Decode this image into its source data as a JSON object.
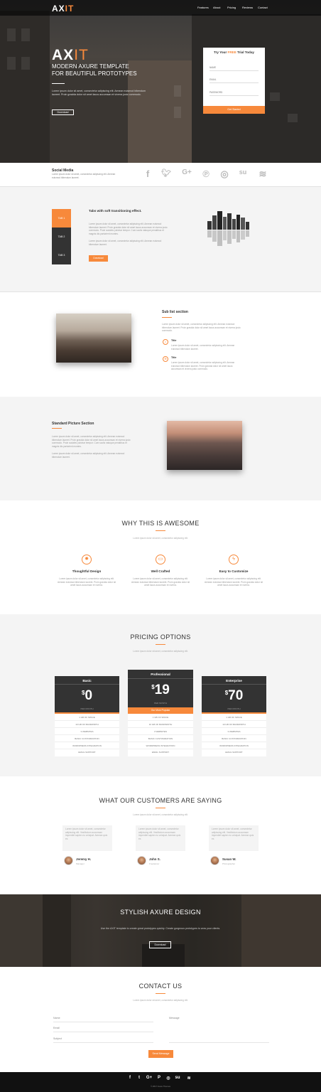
{
  "nav": {
    "logo_main": "AX",
    "logo_accent": "IT",
    "items": [
      "Features",
      "About",
      "Pricing",
      "Reviews",
      "Contact"
    ]
  },
  "hero": {
    "title_main": "AX",
    "title_accent": "IT",
    "subtitle_line1": "MODERN AXURE TEMPLATE",
    "subtitle_line2": "FOR BEAUTIFUL PROTOTYPES",
    "text": "Lorem ipsum dolor sit amet, consectetur adipiscing elit. Aenean euismod bibendum laoreet. Proin gravida dolor sit amet lacus accumsan et viverra justo commodo.",
    "button": "Download"
  },
  "trial": {
    "title_pre": "Try Your ",
    "title_accent": "FREE",
    "title_post": " Trial Today",
    "fields": [
      "NAME",
      "EMAIL",
      "PASSWORD"
    ],
    "button": "Get Started"
  },
  "social": {
    "title": "Social Media",
    "text": "Lorem ipsum dolor sit amet, consectetur adipiscing elit. Aenean euismod bibendum laoreet.",
    "icons": [
      "facebook-icon",
      "twitter-icon",
      "google-plus-icon",
      "pinterest-icon",
      "instagram-icon",
      "stumbleupon-icon",
      "wifi-icon"
    ]
  },
  "tabs": {
    "labels": [
      "TAB 1",
      "TAB 2",
      "TAB 3"
    ],
    "heading": "Tabs with soft transitioning effect.",
    "para1": "Lorem ipsum dolor sit amet, consectetur adipiscing elit. Aenean euismod bibendum laoreet. Proin gravida dolor sit amet lacus accumsan et viverra justo commodo. Proin sodales pulvinar tempor. Cum sociis natoque penatibus et magnis dis parturient montes.",
    "para2": "Lorem ipsum dolor sit amet, consectetur adipiscing elit. Aenean euismod bibendum laoreet.",
    "button": "Download"
  },
  "sublist": {
    "title": "Sub list section",
    "text": "Lorem ipsum dolor sit amet, consectetur adipiscing elit. Aenean euismod bibendum laoreet. Proin gravida dolor sit amet lacus accumsan et viverra justo commodo.",
    "items": [
      {
        "title": "Title",
        "text": "Lorem ipsum dolor sit amet, consectetur adipiscing elit. Aenean euismod bibendum laoreet."
      },
      {
        "title": "Title",
        "text": "Lorem ipsum dolor sit amet, consectetur adipiscing elit. Aenean euismod bibendum laoreet. Proin gravida dolor sit amet lacus accumsan et viverra justo commodo."
      }
    ]
  },
  "standard": {
    "title": "Standard Picture Section",
    "para1": "Lorem ipsum dolor sit amet, consectetur adipiscing elit. Aenean euismod bibendum laoreet. Proin gravida dolor sit amet lacus accumsan et viverra justo commodo. Proin sodales pulvinar tempor. Cum sociis natoque penatibus et magnis dis parturient montes.",
    "para2": "Lorem ipsum dolor sit amet, consectetur adipiscing elit. Aenean euismod bibendum laoreet."
  },
  "why": {
    "title": "WHY THIS IS AWESOME",
    "subtitle": "Lorem ipsum dolor sit amet, consectetur adipiscing elit.",
    "features": [
      {
        "icon": "bulb-icon",
        "glyph": "✹",
        "title": "Thoughtful Design",
        "text": "Lorem ipsum dolor sit amet, consectetur adipiscing elit. Aenean euismod bibendum laoreet. Proin gravida dolor sit amet lacus accumsan et viverra."
      },
      {
        "icon": "monitor-icon",
        "glyph": "▭",
        "title": "Well Crafted",
        "text": "Lorem ipsum dolor sit amet, consectetur adipiscing elit. Aenean euismod bibendum laoreet. Proin gravida dolor sit amet lacus accumsan et viverra."
      },
      {
        "icon": "bolt-icon",
        "glyph": "ϟ",
        "title": "Easy to Customize",
        "text": "Lorem ipsum dolor sit amet, consectetur adipiscing elit. Aenean euismod bibendum laoreet. Proin gravida dolor sit amet lacus accumsan et viverra."
      }
    ]
  },
  "pricing": {
    "title": "PRICING OPTIONS",
    "subtitle": "Lorem ipsum dolor sit amet, consectetur adipiscing elit.",
    "plans": [
      {
        "name": "Basic",
        "currency": "$",
        "price": "0",
        "period": "PER MONTH",
        "cta": ""
      },
      {
        "name": "Professional",
        "currency": "$",
        "price": "19",
        "period": "PER MONTH",
        "cta": "Our Most Popular"
      },
      {
        "name": "Enterprise",
        "currency": "$",
        "price": "70",
        "period": "PER MONTH",
        "cta": ""
      }
    ],
    "features": [
      "1 GB OF SPACE",
      "10 GB OF BANDWIDTH",
      "3 WEBSITES",
      "BASIC CUSTOMIZATION",
      "WORDPRESS INTEGRATION",
      "EMAIL SUPPORT"
    ]
  },
  "testimonials": {
    "title": "WHAT OUR CUSTOMERS ARE SAYING",
    "subtitle": "Lorem ipsum dolor sit amet, consectetur adipiscing elit.",
    "quote": "Lorem ipsum dolor sit amet, consectetur adipiscing elit. Vestibulum accumsan imperdiet sapien eu volutpat. Aenean quis ex.",
    "people": [
      {
        "name": "Jeremy H.",
        "role": "Manager"
      },
      {
        "name": "John S.",
        "role": "Freelancer"
      },
      {
        "name": "Susan W.",
        "role": "Photographer"
      }
    ]
  },
  "stylish": {
    "title": "STYLISH AXURE DESIGN",
    "text": "Use the AXIT template to create great prototypes quickly. Create gorgeous prototypes to wow your clients.",
    "button": "Download"
  },
  "contact": {
    "title": "CONTACT US",
    "subtitle": "Lorem ipsum dolor sit amet, consectetur adipiscing elit.",
    "fields": [
      "Name",
      "Email",
      "Subject"
    ],
    "message": "Message",
    "button": "Send Message"
  },
  "footer": {
    "icons": [
      "f",
      "t",
      "G+",
      "P",
      "◎",
      "su",
      "≋"
    ],
    "copyright": "© 2017 Axure Themes"
  },
  "colors": {
    "accent": "#f7893b",
    "dark": "#333333",
    "light_bg": "#f4f4f4"
  }
}
